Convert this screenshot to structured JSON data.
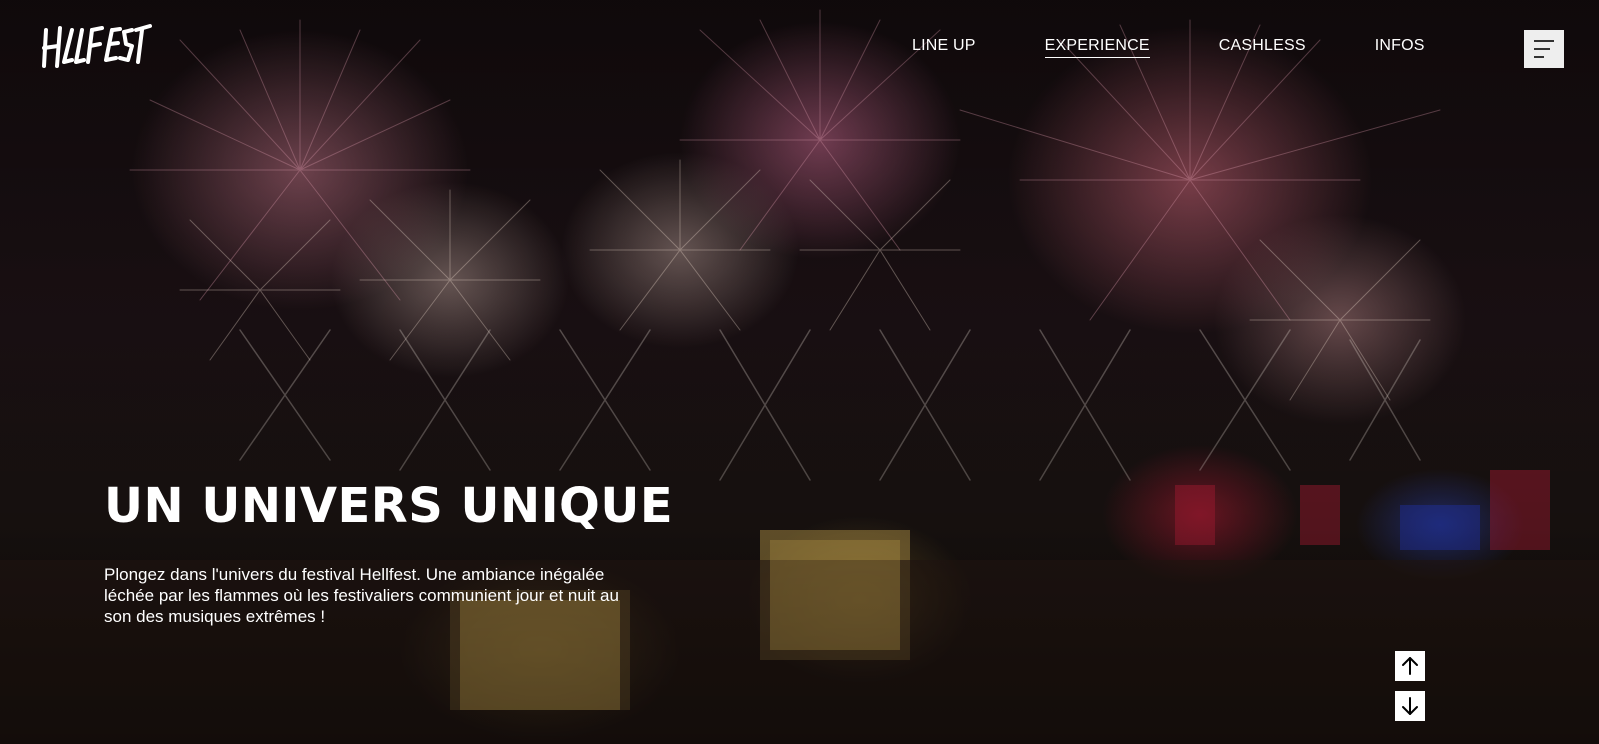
{
  "brand": {
    "logo_text": "HELLFEST"
  },
  "nav": {
    "items": [
      {
        "label": "LINE UP",
        "active": false
      },
      {
        "label": "EXPERIENCE",
        "active": true
      },
      {
        "label": "CASHLESS",
        "active": false
      },
      {
        "label": "INFOS",
        "active": false
      }
    ],
    "menu_icon": "hamburger-menu-icon"
  },
  "hero": {
    "title": "UN UNIVERS UNIQUE",
    "description": "Plongez dans l'univers du festival Hellfest. Une ambiance inégalée léchée par les flammes où les festivaliers communient jour et nuit au son des musiques extrêmes !",
    "background": "fireworks-over-festival-crowd-photo"
  },
  "controls": {
    "up_icon": "arrow-up-icon",
    "down_icon": "arrow-down-icon"
  },
  "colors": {
    "text": "#ffffff",
    "menu_button": "#eeeeee"
  }
}
